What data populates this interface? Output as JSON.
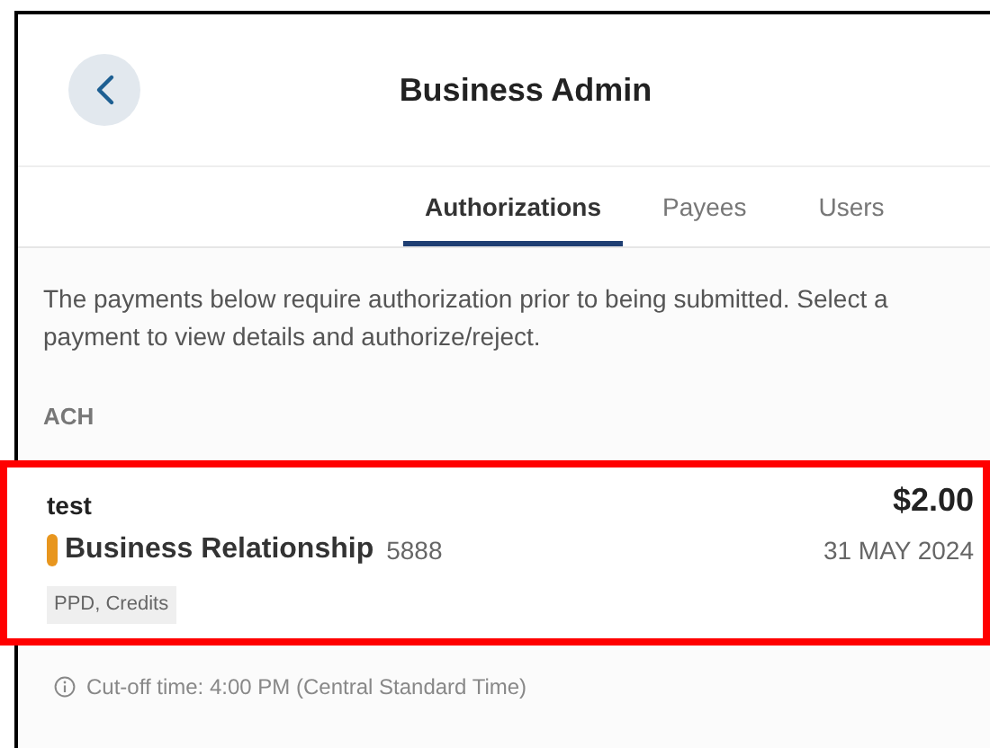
{
  "header": {
    "title": "Business Admin"
  },
  "tabs": [
    {
      "label": "Authorizations",
      "selected": true
    },
    {
      "label": "Payees",
      "selected": false
    },
    {
      "label": "Users",
      "selected": false
    }
  ],
  "intro": "The payments below require authorization prior to being submitted. Select a payment to view details and authorize/reject.",
  "section": "ACH",
  "payments": [
    {
      "name": "test",
      "amount": "$2.00",
      "account": "Business Relationship",
      "account_number": "5888",
      "date": "31 MAY 2024",
      "tag": "PPD, Credits",
      "color": "#e8961e",
      "highlighted": true
    }
  ],
  "cutoff": "Cut-off time: 4:00 PM (Central Standard Time)"
}
